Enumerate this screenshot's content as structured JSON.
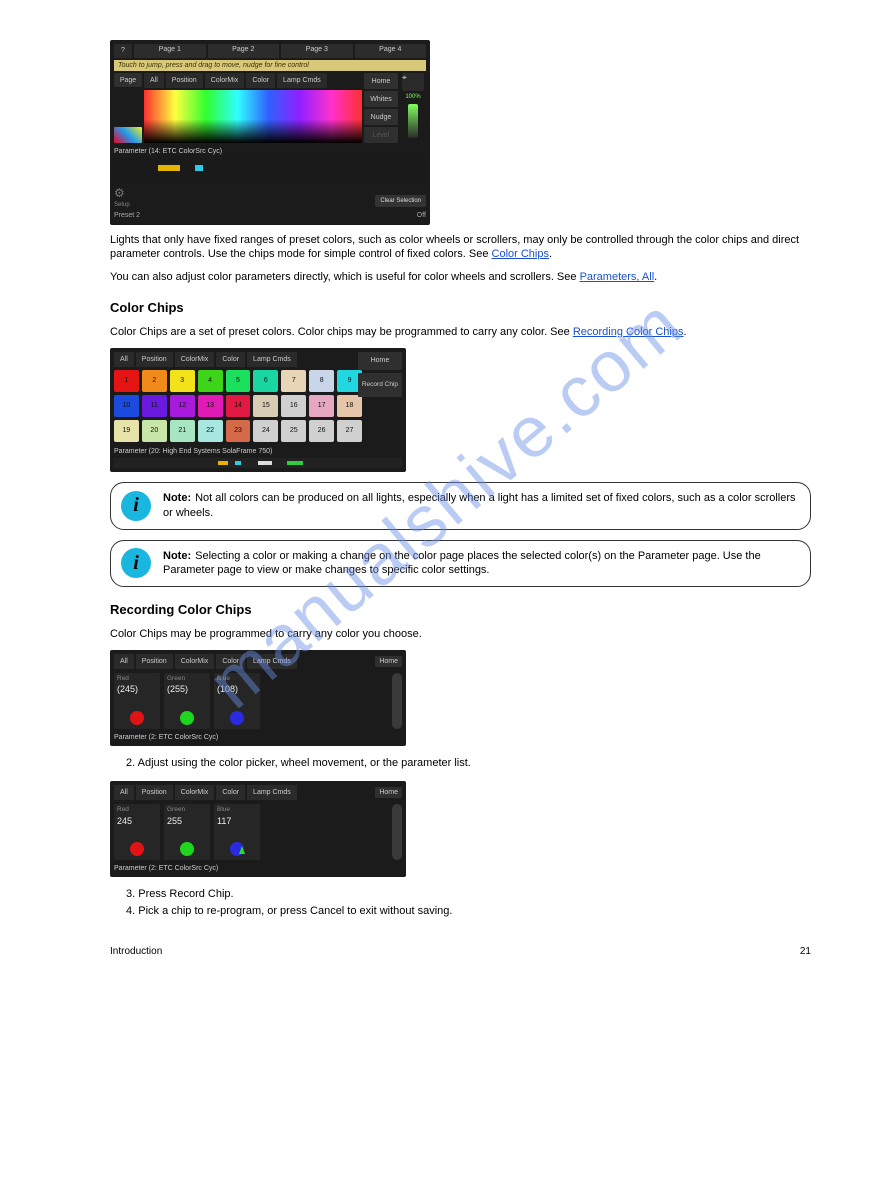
{
  "watermark": "manualshive.com",
  "panel1": {
    "help": "?",
    "pages": [
      "Page 1",
      "Page 2",
      "Page 3",
      "Page 4"
    ],
    "hint": "Touch to jump, press and drag to move, nudge for fine control",
    "leftBtn": "Page",
    "tabs": {
      "all": "All",
      "pos": "Position",
      "mix": "ColorMix",
      "col": "Color",
      "lamp": "Lamp Cmds"
    },
    "right": {
      "home": "Home",
      "whites": "Whites",
      "nudge": "Nudge",
      "level": "Level"
    },
    "param": "Parameter   (14: ETC ColorSrc Cyc)",
    "clear": "Clear Selection",
    "gear": "⚙",
    "setup": "Setup",
    "preset": "Preset 2",
    "off": "Off",
    "pct": "100%"
  },
  "body1": {
    "p1": "Lights that only have fixed ranges of preset colors, such as color wheels or scrollers, may only be controlled through the color chips and direct parameter controls. Use the chips mode for simple control of fixed colors. See ",
    "chipsLink": "Color Chips",
    "p2a": "You can also adjust color parameters directly, which is useful for color wheels and scrollers. See ",
    "paramsLink": "Parameters, All",
    "p2b": "."
  },
  "chipsHeading": "Color Chips",
  "chipsBody": {
    "p1a": "Color Chips are a set of preset colors. Color chips may be programmed to carry any color. See ",
    "recLink": "Recording Color Chips",
    "p1b": "."
  },
  "panel2": {
    "tabs": {
      "all": "All",
      "pos": "Position",
      "mix": "ColorMix",
      "col": "Color",
      "lamp": "Lamp Cmds"
    },
    "home": "Home",
    "record": "Record Chip",
    "param": "Parameter   (20: High End Systems SolaFrame 750)",
    "chips": [
      {
        "n": "1",
        "c": "#e41414"
      },
      {
        "n": "2",
        "c": "#f08a1a"
      },
      {
        "n": "3",
        "c": "#f2e21a"
      },
      {
        "n": "4",
        "c": "#3ed41a"
      },
      {
        "n": "5",
        "c": "#1ae05e"
      },
      {
        "n": "6",
        "c": "#1ad6a0"
      },
      {
        "n": "7",
        "c": "#e8d5b8"
      },
      {
        "n": "8",
        "c": "#c9d5e8"
      },
      {
        "n": "9",
        "c": "#22d8e0"
      },
      {
        "n": "10",
        "c": "#1a4ade"
      },
      {
        "n": "11",
        "c": "#6a1ade"
      },
      {
        "n": "12",
        "c": "#a81ade"
      },
      {
        "n": "13",
        "c": "#e01ab4"
      },
      {
        "n": "14",
        "c": "#e01a42"
      },
      {
        "n": "15",
        "c": "#d8cdb4"
      },
      {
        "n": "16",
        "c": "#d0d0d0"
      },
      {
        "n": "17",
        "c": "#e6a8c0"
      },
      {
        "n": "18",
        "c": "#e6c6a8"
      },
      {
        "n": "19",
        "c": "#e6e3a8"
      },
      {
        "n": "20",
        "c": "#c8e6a8"
      },
      {
        "n": "21",
        "c": "#a8e6c2"
      },
      {
        "n": "22",
        "c": "#a8e6e0"
      },
      {
        "n": "23",
        "c": "#d46a4a"
      },
      {
        "n": "24",
        "c": "#d0d0d0"
      },
      {
        "n": "25",
        "c": "#d0d0d0"
      },
      {
        "n": "26",
        "c": "#d0d0d0"
      },
      {
        "n": "27",
        "c": "#d0d0d0"
      }
    ]
  },
  "note1": {
    "label": "Note:",
    "text": "Not all colors can be produced on all lights, especially when a light has a limited set of fixed colors, such as a color scrollers or wheels."
  },
  "note2": {
    "label": "Note:",
    "text": "Selecting a color or making a change on the color page places the selected color(s) on the Parameter page. Use the Parameter page to view or make changes to specific color settings."
  },
  "recHeading": "Recording Color Chips",
  "recBody": "Color Chips may be programmed to carry any color you choose.",
  "panel3": {
    "tabs": {
      "all": "All",
      "pos": "Position",
      "mix": "ColorMix",
      "col": "Color",
      "lamp": "Lamp Cmds"
    },
    "home": "Home",
    "cols": [
      {
        "label": "Red",
        "value": "(245)",
        "dot": "#e01414"
      },
      {
        "label": "Green",
        "value": "(255)",
        "dot": "#1fd61f"
      },
      {
        "label": "Blue",
        "value": "(108)",
        "dot": "#2a2ae0"
      }
    ],
    "param": "Parameter   (2: ETC ColorSrc Cyc)"
  },
  "between34": "2. Adjust using the color picker, wheel movement, or the parameter list.",
  "panel4": {
    "tabs": {
      "all": "All",
      "pos": "Position",
      "mix": "ColorMix",
      "col": "Color",
      "lamp": "Lamp Cmds"
    },
    "home": "Home",
    "cols": [
      {
        "label": "Red",
        "value": "245",
        "dot": "#e01414"
      },
      {
        "label": "Green",
        "value": "255",
        "dot": "#1fd61f"
      },
      {
        "label": "Blue",
        "value": "117",
        "dot": "#2a2ae0"
      }
    ],
    "param": "Parameter   (2: ETC ColorSrc Cyc)"
  },
  "after4": {
    "line1": "3. Press Record Chip.",
    "line2": "4. Pick a chip to re-program, or press Cancel to exit without saving."
  },
  "footer": {
    "left": "Introduction",
    "right": "21"
  }
}
